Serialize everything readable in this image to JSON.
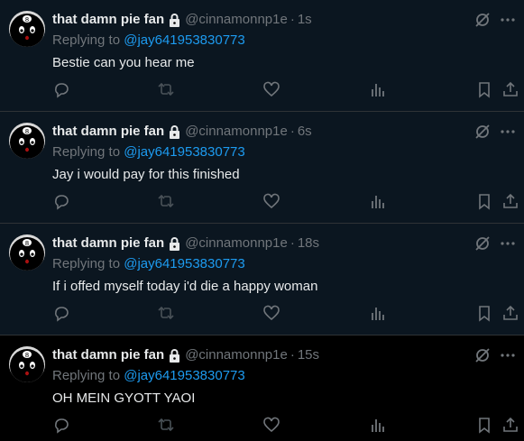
{
  "tweets": [
    {
      "name": "that damn pie fan",
      "handle": "@cinnamonnp1e",
      "time": "1s",
      "replying_prefix": "Replying to",
      "replying_to": "@jay641953830773",
      "text": "Bestie can you hear me"
    },
    {
      "name": "that damn pie fan",
      "handle": "@cinnamonnp1e",
      "time": "6s",
      "replying_prefix": "Replying to",
      "replying_to": "@jay641953830773",
      "text": "Jay i would pay for this finished"
    },
    {
      "name": "that damn pie fan",
      "handle": "@cinnamonnp1e",
      "time": "18s",
      "replying_prefix": "Replying to",
      "replying_to": "@jay641953830773",
      "text": "If i offed myself today i'd die a happy woman"
    },
    {
      "name": "that damn pie fan",
      "handle": "@cinnamonnp1e",
      "time": "15s",
      "replying_prefix": "Replying to",
      "replying_to": "@jay641953830773",
      "text": "OH MEIN GYOTT YAOI"
    }
  ],
  "separator": "·",
  "colors": {
    "background": "#000000",
    "dim_background": "#0b1620",
    "text": "#e7e9ea",
    "muted": "#71767b",
    "link": "#1d9bf0",
    "border": "#2f3336"
  },
  "icons": {
    "avatar": "eight-ball-avatar",
    "lock": "lock-icon",
    "grok": "grok-icon",
    "more": "more-icon",
    "reply": "reply-icon",
    "retweet": "retweet-icon",
    "like": "heart-icon",
    "views": "views-icon",
    "bookmark": "bookmark-icon",
    "share": "share-icon"
  }
}
